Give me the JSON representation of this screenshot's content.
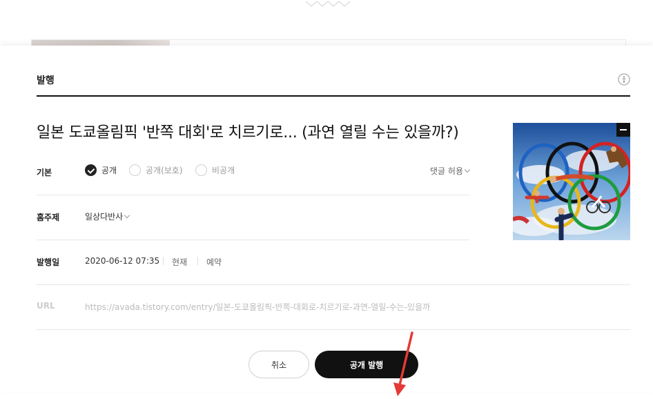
{
  "modal": {
    "title": "발행",
    "post_title": "일본 도쿄올림픽 '반쪽 대회'로 치르기로... (과연 열릴 수는 있을까?)"
  },
  "visibility": {
    "label": "기본",
    "options": [
      {
        "label": "공개",
        "checked": true
      },
      {
        "label": "공개(보호)",
        "checked": false
      },
      {
        "label": "비공개",
        "checked": false
      }
    ],
    "comment": "댓글 허용"
  },
  "category": {
    "label": "홈주제",
    "value": "일상다반사"
  },
  "publish_date": {
    "label": "발행일",
    "value": "2020-06-12 07:35",
    "now": "현재",
    "reserve": "예약"
  },
  "url": {
    "label": "URL",
    "value": "https://avada.tistory.com/entry/일본-도쿄올림픽-반쪽-대회로-치르기로-과연-열릴-수는-있을까"
  },
  "buttons": {
    "cancel": "취소",
    "publish": "공개 발행"
  },
  "colors": {
    "accent": "#111111",
    "annotation_arrow": "#e53935"
  }
}
